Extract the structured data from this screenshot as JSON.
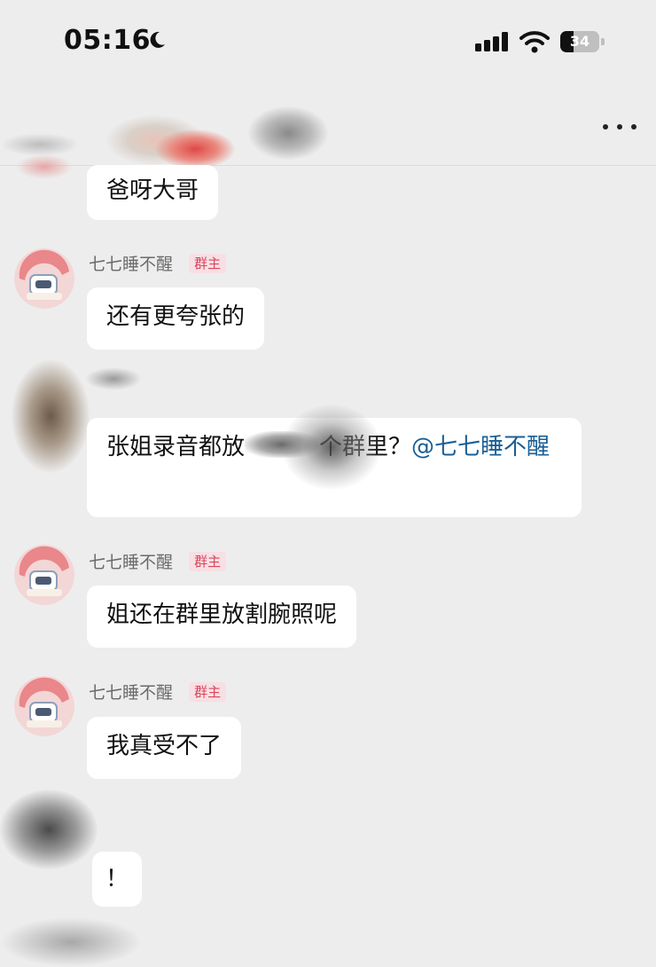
{
  "status_bar": {
    "time": "05:16",
    "battery_level": "34",
    "battery_fraction": 0.34,
    "icons": [
      "moon-icon",
      "cellular-signal-icon",
      "wifi-icon",
      "battery-icon"
    ]
  },
  "header": {
    "more_icon": "more-dots-icon"
  },
  "colors": {
    "background": "#ededed",
    "bubble": "#ffffff",
    "mention": "#1a5f96",
    "badge_text": "#d9455d",
    "badge_bg": "#f7dfe3"
  },
  "messages": [
    {
      "text": "爸呀大哥"
    },
    {
      "sender": "七七睡不醒",
      "badge": "群主",
      "text": "还有更夸张的"
    },
    {
      "text_before": "张姐录音都放",
      "text_after": "个群里？",
      "mention": "@七七睡不醒"
    },
    {
      "sender": "七七睡不醒",
      "badge": "群主",
      "text": "姐还在群里放割腕照呢"
    },
    {
      "sender": "七七睡不醒",
      "badge": "群主",
      "text": "我真受不了"
    },
    {
      "text": "！"
    }
  ]
}
